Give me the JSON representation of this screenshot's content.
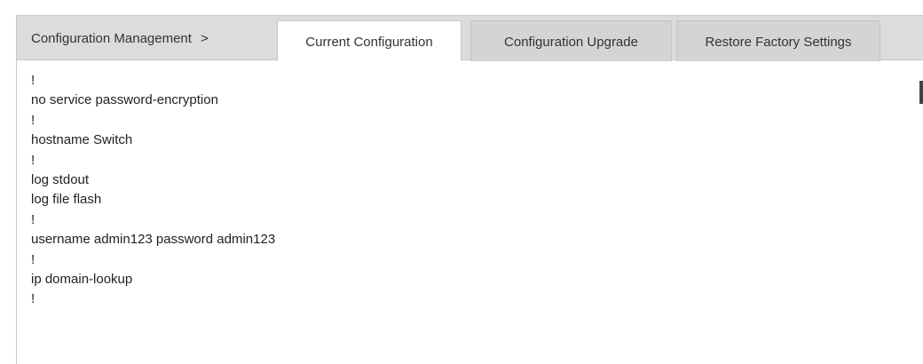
{
  "breadcrumb": {
    "label": "Configuration Management",
    "separator": ">"
  },
  "tabs": {
    "current": "Current Configuration",
    "upgrade": "Configuration Upgrade",
    "restore": "Restore Factory Settings",
    "active": "current"
  },
  "config": {
    "lines": [
      "!",
      "no service password-encryption",
      "!",
      "hostname Switch",
      "!",
      "log stdout",
      "log file flash",
      "!",
      "username admin123 password admin123",
      "!",
      "ip domain-lookup",
      "!"
    ]
  },
  "colors": {
    "tabbar_background": "#dcdcdc",
    "active_tab_background": "#ffffff",
    "text": "#222222"
  }
}
